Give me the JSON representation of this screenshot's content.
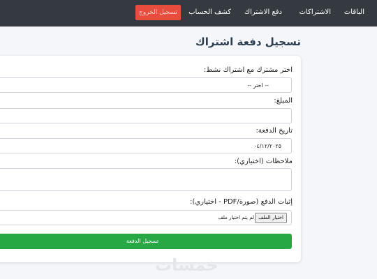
{
  "nav": {
    "items": [
      "الباقات",
      "الاشتراكات",
      "دفع الاشتراك",
      "كشف الحساب"
    ],
    "logout_label": "تسجيل الخروج"
  },
  "page": {
    "title": "تسجيل دفعة اشتراك"
  },
  "form": {
    "subscriber_label": "اختر مشترك مع اشتراك نشط:",
    "subscriber_selected": "-- اختر --",
    "amount_label": "المبلغ:",
    "amount_value": "",
    "date_label": "تاريخ الدفعة:",
    "date_value": "٠٤/١٢/٢٠٢٥",
    "notes_label": "ملاحظات (اختياري):",
    "notes_value": "",
    "proof_label": "إثبات الدفع (صورة/PDF - اختياري):",
    "file_button_label": "اختيار الملف",
    "file_status": "لم يتم اختيار ملف",
    "submit_label": "تسجيل الدفعة"
  },
  "watermark": {
    "text": "خمسات"
  },
  "colors": {
    "navbar": "#343a40",
    "logout": "#e74c3c",
    "submit": "#28a745",
    "title": "#2c3e50"
  }
}
